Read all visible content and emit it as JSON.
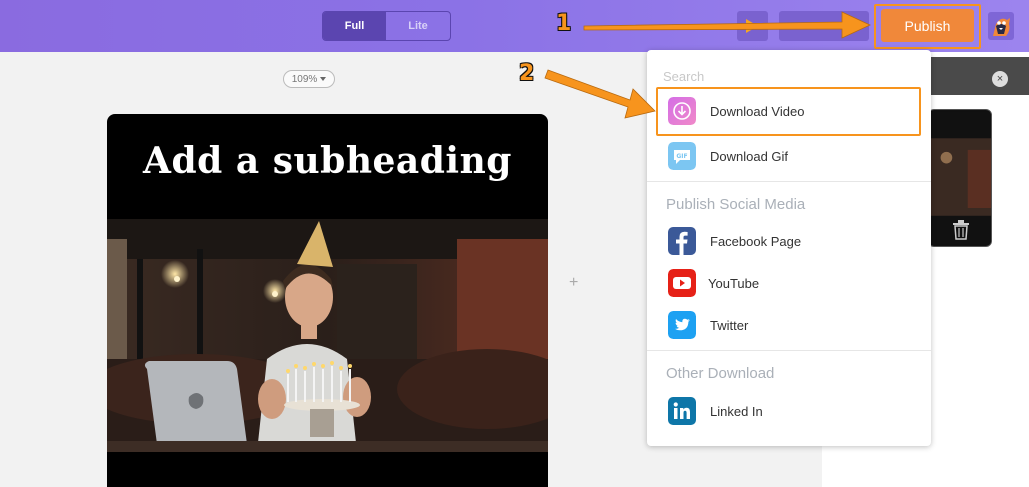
{
  "toolbar": {
    "mode_full": "Full",
    "mode_lite": "Lite",
    "publish_label": "Publish"
  },
  "canvas": {
    "zoom": "109%",
    "subheading": "Add a subheading",
    "add_symbol": "+"
  },
  "panel": {
    "close_symbol": "×"
  },
  "menu": {
    "search_placeholder": "Search",
    "items": [
      {
        "label": "Download Video",
        "icon": "download-video-icon"
      },
      {
        "label": "Download Gif",
        "icon": "gif-icon"
      },
      {
        "label": "Facebook Page",
        "icon": "facebook-icon"
      },
      {
        "label": "YouTube",
        "icon": "youtube-icon"
      },
      {
        "label": "Twitter",
        "icon": "twitter-icon"
      },
      {
        "label": "Linked In",
        "icon": "linkedin-icon"
      }
    ],
    "sections": {
      "social": "Publish Social Media",
      "other": "Other Download"
    }
  },
  "annotations": {
    "step1": "1",
    "step2": "2"
  },
  "colors": {
    "accent_orange": "#f7941d",
    "publish_button": "#f0883a",
    "topbar": "#8b72e6",
    "facebook": "#3b5998",
    "youtube": "#e62117",
    "twitter": "#1da1f2",
    "linkedin": "#0e76a8"
  }
}
